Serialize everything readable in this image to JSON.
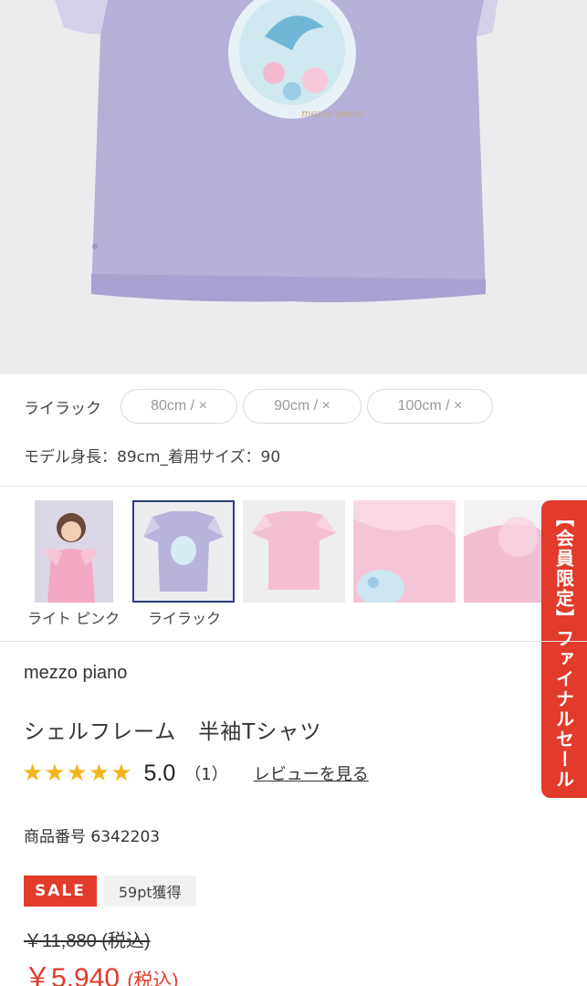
{
  "hero": {
    "image_name": "lilac-tshirt-main-photo"
  },
  "variant": {
    "color_label": "ライラック",
    "sizes": [
      {
        "label": "80cm / ×"
      },
      {
        "label": "90cm / ×"
      },
      {
        "label": "100cm / ×"
      }
    ],
    "model_info": "モデル身長：89cm_着用サイズ：90"
  },
  "thumbnails": [
    {
      "label": "ライト ピンク",
      "selected": false
    },
    {
      "label": "ライラック",
      "selected": true
    },
    {
      "label": "",
      "selected": false
    },
    {
      "label": "",
      "selected": false
    },
    {
      "label": "",
      "selected": false
    }
  ],
  "side_banner": {
    "text": "【会員限定】ファイナルセール"
  },
  "product": {
    "brand": "mezzo piano",
    "name": "シェルフレーム　半袖Tシャツ",
    "rating_stars": "★★★★★",
    "rating_value": "5.0",
    "review_count": "（1）",
    "review_link": "レビューを見る",
    "sku": "商品番号 6342203",
    "sale_badge": "SALE",
    "points": "59pt獲得",
    "old_price": "￥11,880 (税込)",
    "new_price": "￥5,940",
    "new_price_tax": "(税込)"
  },
  "colors": {
    "accent_red": "#e23a2b",
    "star_gold": "#f2b51c",
    "selected_outline": "#2a3f7a"
  }
}
